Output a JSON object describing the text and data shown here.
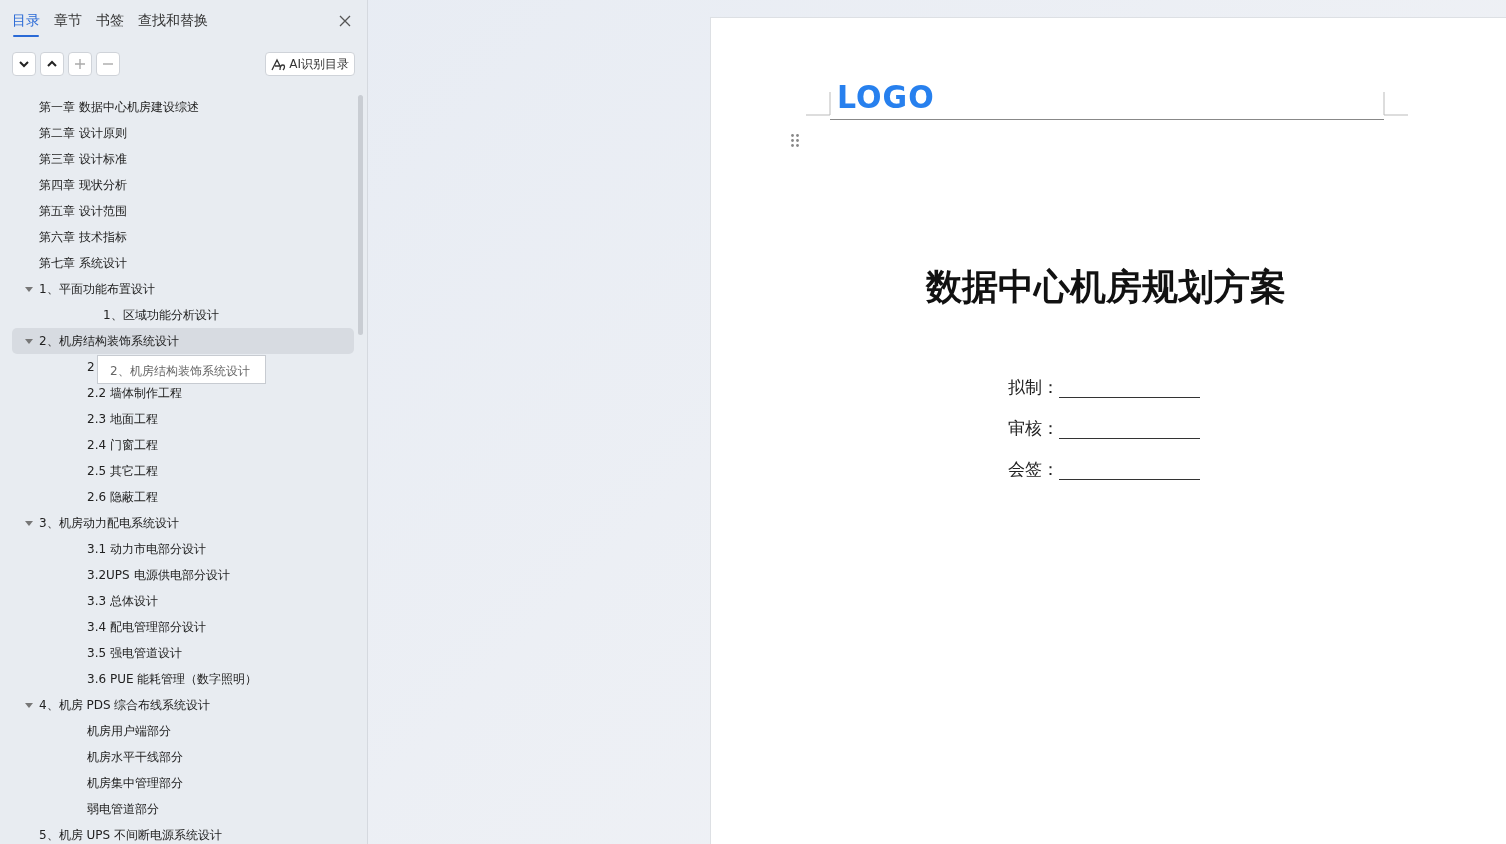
{
  "panel": {
    "tabs": [
      {
        "label": "目录",
        "selected": true
      },
      {
        "label": "章节",
        "selected": false
      },
      {
        "label": "书签",
        "selected": false
      },
      {
        "label": "查找和替换",
        "selected": false
      }
    ],
    "toolbar": {
      "ai_button": "AI识别目录"
    },
    "toc": [
      {
        "label": "第一章   数据中心机房建设综述",
        "selected": false
      },
      {
        "label": "第二章  设计原则",
        "selected": false
      },
      {
        "label": "第三章  设计标准",
        "selected": false
      },
      {
        "label": "第四章  现状分析",
        "selected": false
      },
      {
        "label": "第五章  设计范围",
        "selected": false
      },
      {
        "label": "第六章  技术指标",
        "selected": false
      },
      {
        "label": "第七章  系统设计",
        "selected": false
      },
      {
        "label": "1、平面功能布置设计",
        "selected": false,
        "expanded": true,
        "children": [
          {
            "label": "1、区域功能分析设计",
            "selected": false,
            "kind": "deep"
          }
        ]
      },
      {
        "label": "2、机房结构装饰系统设计",
        "selected": true,
        "expanded": true,
        "children": [
          {
            "label": "2",
            "selected": false
          },
          {
            "label": "2.2 墙体制作工程",
            "selected": false
          },
          {
            "label": "2.3 地面工程",
            "selected": false
          },
          {
            "label": "2.4 门窗工程",
            "selected": false
          },
          {
            "label": "2.5 其它工程",
            "selected": false
          },
          {
            "label": "2.6 隐蔽工程",
            "selected": false
          }
        ]
      },
      {
        "label": "3、机房动力配电系统设计",
        "selected": false,
        "expanded": true,
        "children": [
          {
            "label": "3.1 动力市电部分设计",
            "selected": false
          },
          {
            "label": "3.2UPS 电源供电部分设计",
            "selected": false
          },
          {
            "label": "3.3 总体设计",
            "selected": false
          },
          {
            "label": "3.4 配电管理部分设计",
            "selected": false
          },
          {
            "label": "3.5 强电管道设计",
            "selected": false
          },
          {
            "label": "3.6 PUE 能耗管理（数字照明）",
            "selected": false
          }
        ]
      },
      {
        "label": "4、机房 PDS 综合布线系统设计",
        "selected": false,
        "expanded": true,
        "children": [
          {
            "label": "机房用户端部分",
            "selected": false
          },
          {
            "label": "机房水平干线部分",
            "selected": false
          },
          {
            "label": "机房集中管理部分",
            "selected": false
          },
          {
            "label": "弱电管道部分",
            "selected": false
          }
        ]
      },
      {
        "label": "5、机房 UPS  不间断电源系统设计",
        "selected": false
      }
    ],
    "tooltip": "2、机房结构装饰系统设计"
  },
  "document": {
    "logo": "LOGO",
    "title": "数据中心机房规划方案",
    "signatures": [
      {
        "label": "拟制："
      },
      {
        "label": "审核："
      },
      {
        "label": "会签："
      }
    ]
  }
}
